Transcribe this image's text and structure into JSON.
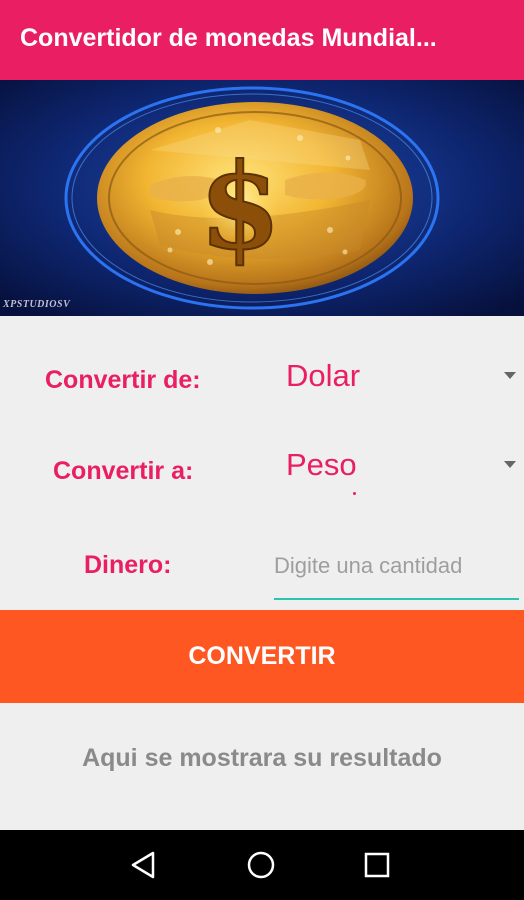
{
  "app_bar": {
    "title": "Convertidor de monedas Mundial..."
  },
  "banner": {
    "watermark": "XPSTUDIOSV",
    "icon": "dollar-coin"
  },
  "form": {
    "from_label": "Convertir de:",
    "from_value": "Dolar",
    "to_label": "Convertir a:",
    "to_value": "Peso",
    "amount_label": "Dinero:",
    "amount_placeholder": "Digite una cantidad",
    "amount_value": ""
  },
  "convert_button": {
    "label": "CONVERTIR"
  },
  "result": {
    "text": "Aqui se mostrara su resultado"
  },
  "navigation": {
    "back": "back-icon",
    "home": "home-icon",
    "recents": "recents-icon"
  },
  "colors": {
    "primary": "#e91e63",
    "button": "#ff5722",
    "input_underline": "#26c6b0",
    "result_text": "#8a8a8a",
    "background": "#efefef"
  }
}
